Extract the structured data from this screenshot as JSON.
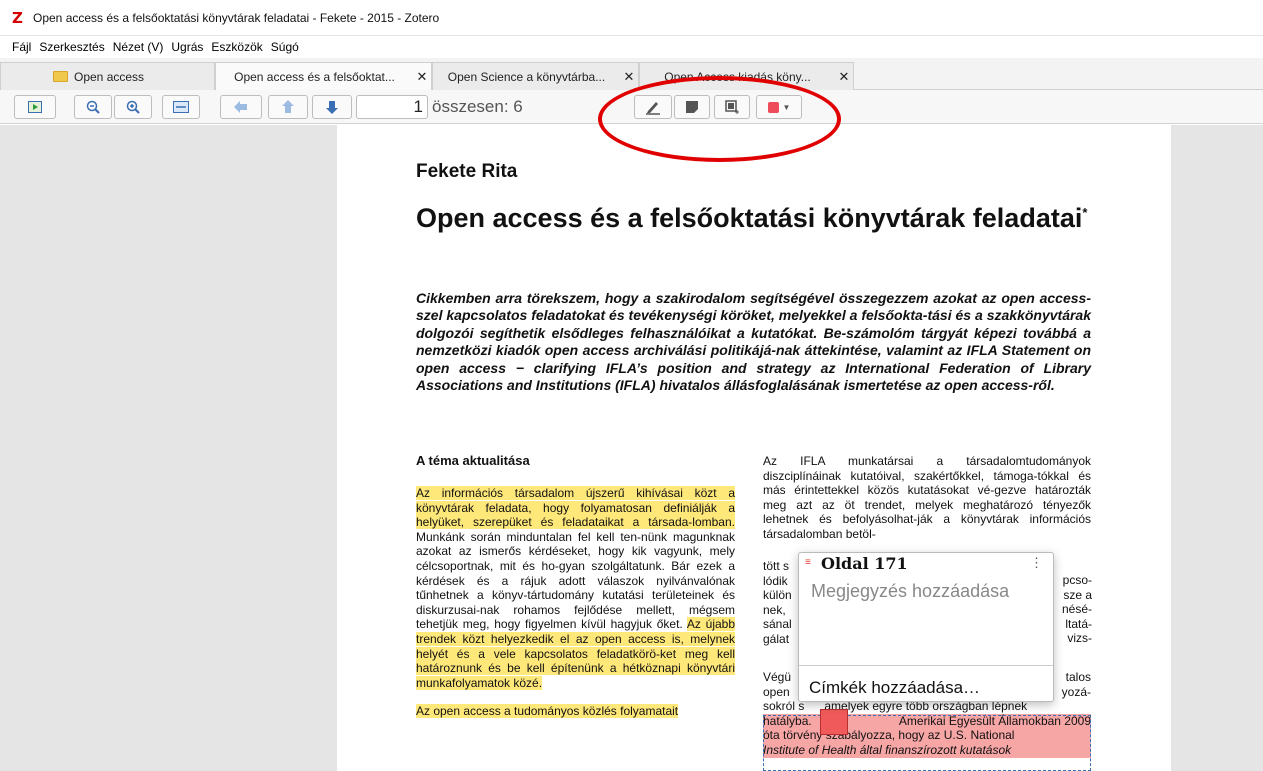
{
  "window": {
    "title": "Open access és a felsőoktatási könyvtárak feladatai - Fekete - 2015 - Zotero",
    "logo": "Z"
  },
  "menu": [
    "Fájl",
    "Szerkesztés",
    "Nézet (V)",
    "Ugrás",
    "Eszközök",
    "Súgó"
  ],
  "tabs": [
    {
      "label": "Open access"
    },
    {
      "label": "Open access és a felsőoktat...",
      "close": "✕"
    },
    {
      "label": "Open Science a könyvtárba...",
      "close": "✕"
    },
    {
      "label": "Open Access kiadás köny...",
      "close": "✕"
    }
  ],
  "toolbar": {
    "page_number": "1",
    "page_total": "összesen: 6",
    "annotation_color": "#ee4b5b"
  },
  "paper": {
    "author": "Fekete Rita",
    "title": "Open access és a felsőoktatási könyvtárak feladatai",
    "title_mark": "*",
    "abstract": "Cikkemben arra törekszem, hogy a szakirodalom segítségével összegezzem azokat az open access-szel kapcsolatos feladatokat és tevékenységi köröket, melyekkel a felsőokta-tási és a szakkönyvtárak dolgozói segíthetik elsődleges felhasználóikat a kutatókat. Be-számolóm tárgyát képezi továbbá a nemzetközi kiadók open access archiválási politikájá-nak áttekintése, valamint az IFLA Statement on open access − clarifying IFLA’s position and strategy az International Federation of Library Associations and Institutions (IFLA) hivatalos állásfoglalásának ismertetése az open access-ről.",
    "section_heading": "A téma aktualitása",
    "left_hl1": "Az információs társadalom újszerű kihívásai közt a könyvtárak feladata, hogy folyamatosan definiálják a helyüket, szerepüket és feladataikat a társada-lomban.",
    "left_body": " Munkánk során minduntalan fel kell ten-nünk magunknak azokat az ismerős kérdéseket, hogy kik vagyunk, mely célcsoportnak, mit és ho-gyan szolgáltatunk. Bár ezek a kérdések és a rájuk adott válaszok nyilvánvalónak tűnhetnek a könyv-tártudomány kutatási területeinek és diskurzusai-nak rohamos fejlődése mellett, mégsem tehetjük meg, hogy figyelmen kívül hagyjuk őket. ",
    "left_hl2": "Az újabb trendek közt helyezkedik el az open access is, melynek helyét és a vele kapcsolatos feladatkörö-ket meg kell határoznunk és be kell építenünk a hétköznapi könyvtári munkafolyamatok közé.",
    "left_hl3": "Az open access a tudományos közlés folyamatait",
    "right_top": "Az IFLA munkatársai a társadalomtudományok diszciplínáinak kutatóival, szakértőkkel, támoga-tókkal és más érintettekkel közös kutatásokat vé-gezve határozták meg azt az öt trendet, melyek meghatározó tényezők lehetnek és befolyásolhat-ják a könyvtárak információs társadalomban betöl-",
    "right_frag1": [
      "tött s",
      "lódik",
      "külön",
      "nek,",
      "sánal",
      "gálat"
    ],
    "right_frag2": [
      "pcso-",
      "sze a",
      "nésé-",
      "ltatá-",
      "vizs-"
    ],
    "right_bottom1": "Végü",
    "right_bottom1b": "talos",
    "right_bottom2": "open",
    "right_bottom2b": "yozá-",
    "right_bottom3": "sokról s      amelyek egyre több országban lépnek",
    "right_bottom4a": "hatályba.",
    "right_bottom4b": "Amerikai Egyesült Államokban 2009",
    "right_bottom5": "óta törvény szabályozza, hogy az U.S. National",
    "right_bottom6": "Institute of Health által finanszírozott kutatások"
  },
  "annotation_popup": {
    "page_label": "Oldal 171",
    "note_placeholder": "Megjegyzés hozzáadása",
    "tags_label": "Címkék hozzáadása…",
    "menu": "⋮"
  }
}
